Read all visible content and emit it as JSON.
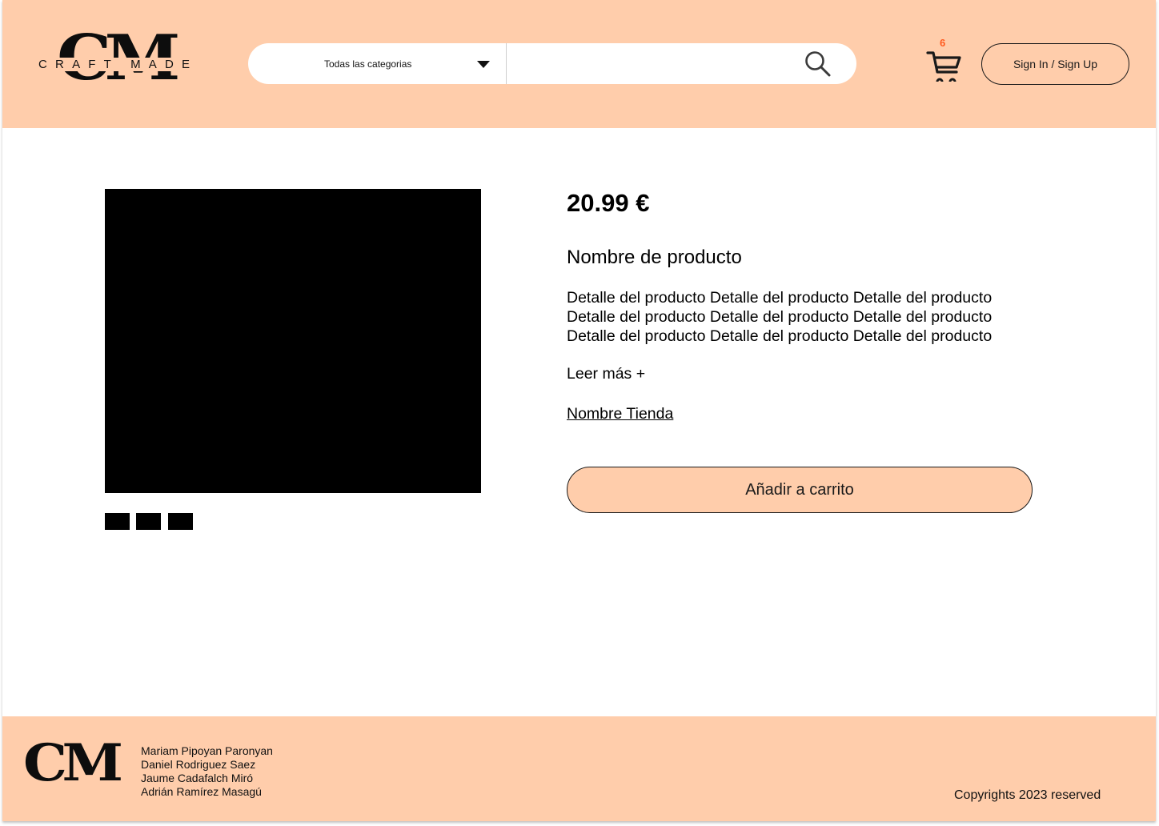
{
  "header": {
    "logo_mark": "CM",
    "logo_text": "CRAFT MADE",
    "search": {
      "category_label": "Todas las categorias",
      "input_value": "",
      "input_placeholder": ""
    },
    "cart_count": "6",
    "signin_label": "Sign In / Sign Up"
  },
  "product": {
    "price": "20.99 €",
    "name": "Nombre de producto",
    "detail_lines": [
      "Detalle del producto Detalle del producto Detalle del producto",
      "Detalle del producto Detalle del producto Detalle del producto",
      "Detalle del producto Detalle del producto Detalle del producto"
    ],
    "read_more": "Leer más +",
    "store_name": "Nombre Tienda",
    "add_to_cart": "Añadir a carrito",
    "thumbnail_count": 3
  },
  "footer": {
    "logo_mark": "CM",
    "authors": [
      "Mariam Pipoyan Paronyan",
      "Daniel Rodriguez Saez",
      "Jaume Cadafalch Miró",
      "Adrián Ramírez Masagú"
    ],
    "copyright": "Copyrights 2023 reserved"
  },
  "colors": {
    "brand_peach": "#ffcdab",
    "cart_badge": "#ff5a1f",
    "text_dark": "#1a1a1a"
  },
  "icons": {
    "search": "search-icon",
    "cart": "cart-icon",
    "category_dropdown": "caret-down-icon"
  }
}
